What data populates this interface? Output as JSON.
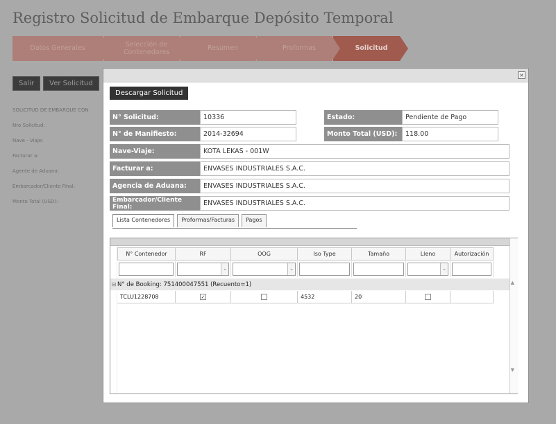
{
  "page": {
    "title": "Registro Solicitud de Embarque Depósito Temporal"
  },
  "wizard": {
    "steps": [
      {
        "label": "Datos Generales"
      },
      {
        "label": "Selección de Contenedores"
      },
      {
        "label": "Resumen"
      },
      {
        "label": "Proformas"
      },
      {
        "label": "Solicitud"
      }
    ]
  },
  "actions": {
    "exit": "Salir",
    "view": "Ver Solicitud"
  },
  "summary": {
    "heading": "SOLICITUD DE EMBARQUE CON",
    "fields": [
      "Nro Solicitud:",
      "Nave - Viaje:",
      "Facturar a:",
      "Agente de Aduana:",
      "Embarcador/Cliente Final:",
      "Monto Total (USD):"
    ]
  },
  "modal": {
    "close": "×",
    "download": "Descargar Solicitud",
    "form": {
      "nro_label": "N° Solicitud:",
      "nro_value": "10336",
      "estado_label": "Estado:",
      "estado_value": "Pendiente de Pago",
      "manif_label": "N° de Manifiesto:",
      "manif_value": "2014-32694",
      "monto_label": "Monto Total (USD):",
      "monto_value": "118.00",
      "nave_label": "Nave-Viaje:",
      "nave_value": "KOTA LEKAS - 001W",
      "facturar_label": "Facturar a:",
      "facturar_value": "ENVASES INDUSTRIALES S.A.C.",
      "agencia_label": "Agencia de Aduana:",
      "agencia_value": "ENVASES INDUSTRIALES S.A.C.",
      "embarcador_label": "Embarcador/Cliente Final:",
      "embarcador_value": "ENVASES INDUSTRIALES S.A.C."
    },
    "tabs": [
      "Lista Contenedores",
      "Proformas/Facturas",
      "Pagos"
    ],
    "grid": {
      "columns": [
        "N° Contenedor",
        "RF",
        "OOG",
        "Iso Type",
        "Tamaño",
        "Lleno",
        "Autorización"
      ],
      "group": "N° de Booking: 751400047551 (Recuento=1)",
      "row": {
        "contenedor": "TCLU1228708",
        "rf": "✓",
        "oog": "",
        "iso": "4532",
        "tamano": "20",
        "lleno": "",
        "autorizacion": ""
      }
    }
  }
}
